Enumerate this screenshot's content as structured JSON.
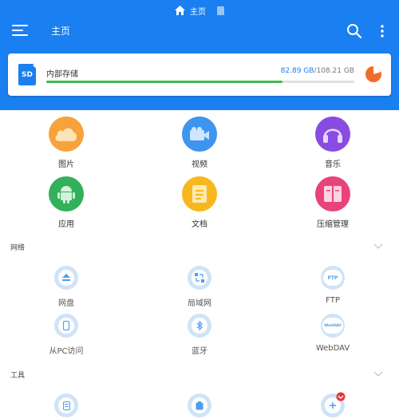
{
  "breadcrumb": {
    "label": "主页"
  },
  "toolbar": {
    "title": "主页"
  },
  "storage": {
    "name": "内部存储",
    "used": "82.89 GB",
    "separator": "/",
    "total": "108.21 GB",
    "used_fraction": 0.766,
    "sd_label": "SD"
  },
  "categories": [
    {
      "label": "图片",
      "color": "#f7a23a"
    },
    {
      "label": "视频",
      "color": "#3d95f0"
    },
    {
      "label": "音乐",
      "color": "#8a4be3"
    },
    {
      "label": "应用",
      "color": "#33b05a"
    },
    {
      "label": "文档",
      "color": "#f6b81c"
    },
    {
      "label": "压缩管理",
      "color": "#e8437c"
    }
  ],
  "network": {
    "title": "网络",
    "items": [
      {
        "label": "网盘"
      },
      {
        "label": "局域网"
      },
      {
        "label": "FTP"
      },
      {
        "label": "从PC访问"
      },
      {
        "label": "蓝牙"
      },
      {
        "label": "WebDAV"
      }
    ]
  },
  "tools": {
    "title": "工具"
  },
  "colors": {
    "accent": "#1a7ff0",
    "progress": "#47b84c",
    "pie": "#f26b2a"
  }
}
